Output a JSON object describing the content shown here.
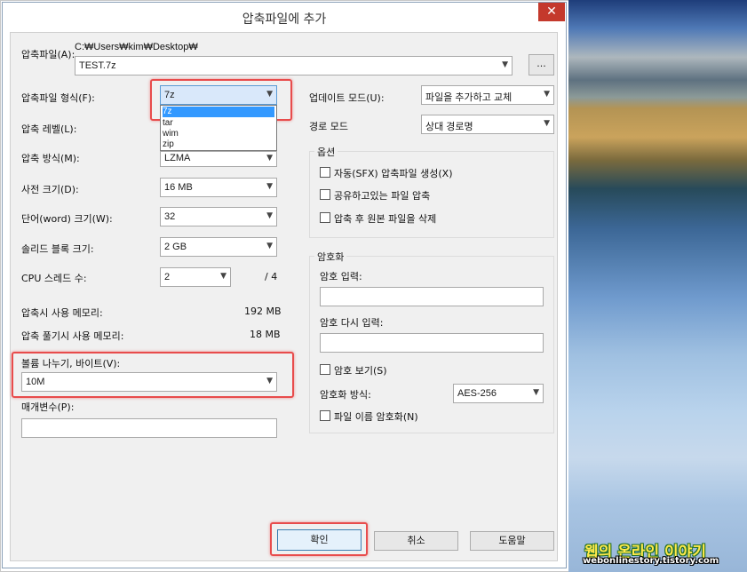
{
  "window": {
    "title": "압축파일에 추가",
    "close_glyph": "✕"
  },
  "archive": {
    "label": "압축파일(A):",
    "path": "C:₩Users₩kim₩Desktop₩",
    "name": "TEST.7z",
    "browse_label": "..."
  },
  "left": {
    "format_label": "압축파일 형식(F):",
    "format_value": "7z",
    "format_options": [
      "7z",
      "tar",
      "wim",
      "zip"
    ],
    "level_label": "압축 레벨(L):",
    "method_label": "압축 방식(M):",
    "method_value": "LZMA",
    "dict_label": "사전 크기(D):",
    "dict_value": "16 MB",
    "word_label": "단어(word) 크기(W):",
    "word_value": "32",
    "solid_label": "솔리드 블록 크기:",
    "solid_value": "2 GB",
    "cpu_label": "CPU 스레드 수:",
    "cpu_value": "2",
    "cpu_total": "/ 4",
    "mem_comp_label": "압축시 사용 메모리:",
    "mem_comp_value": "192 MB",
    "mem_decomp_label": "압축 풀기시 사용 메모리:",
    "mem_decomp_value": "18 MB",
    "volume_label": "볼륨 나누기, 바이트(V):",
    "volume_value": "10M",
    "params_label": "매개변수(P):",
    "params_value": ""
  },
  "right": {
    "update_label": "업데이트 모드(U):",
    "update_value": "파일을 추가하고 교체",
    "path_label": "경로 모드",
    "path_value": "상대 경로명",
    "options_title": "옵션",
    "opt_sfx": "자동(SFX) 압축파일 생성(X)",
    "opt_shared": "공유하고있는 파일 압축",
    "opt_delete": "압축 후 원본 파일을 삭제",
    "enc_title": "암호화",
    "pw_label": "암호 입력:",
    "pw_value": "",
    "pw2_label": "암호 다시 입력:",
    "pw2_value": "",
    "show_pw": "암호 보기(S)",
    "enc_method_label": "암호화 방식:",
    "enc_method_value": "AES-256",
    "enc_names": "파일 이름 암호화(N)"
  },
  "buttons": {
    "ok": "확인",
    "cancel": "취소",
    "help": "도움말"
  },
  "watermark": {
    "line1": "웹의 온라인 이야기",
    "line2": "webonlinestory.tistory.com"
  },
  "colors": {
    "highlight": "#e84c4c",
    "selection": "#3399ff",
    "close": "#c4392c"
  }
}
